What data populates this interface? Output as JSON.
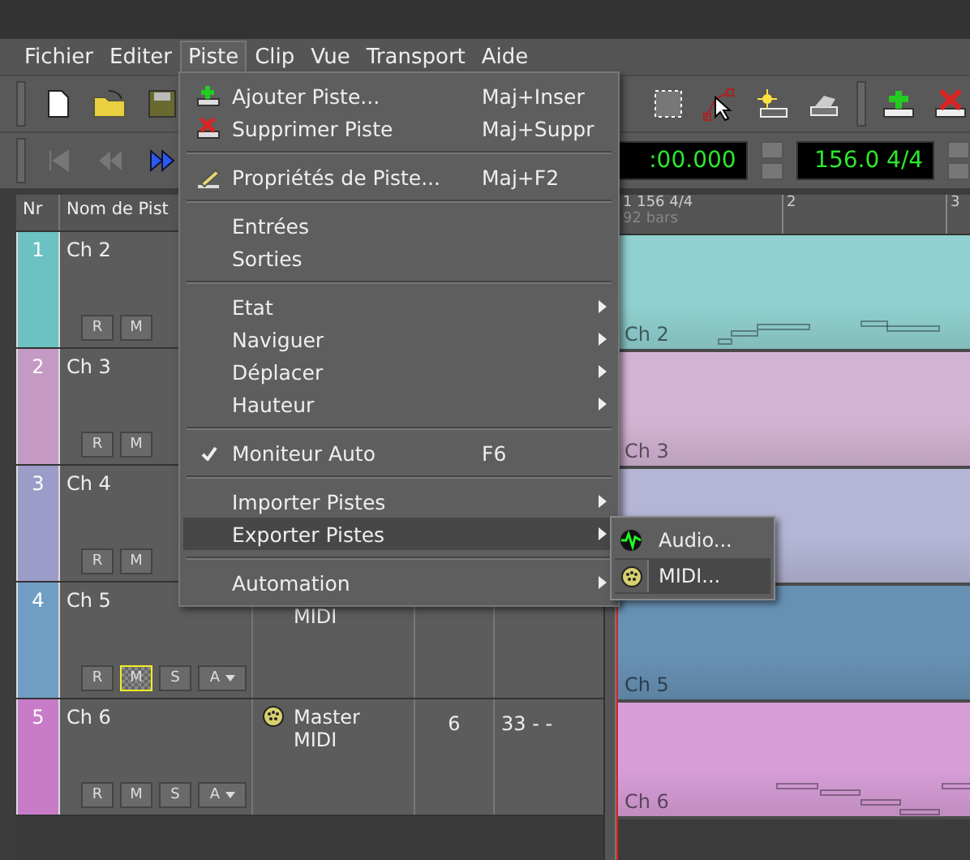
{
  "menubar": [
    {
      "label": "Fichier",
      "selected": false
    },
    {
      "label": "Editer",
      "selected": false
    },
    {
      "label": "Piste",
      "selected": true
    },
    {
      "label": "Clip",
      "selected": false
    },
    {
      "label": "Vue",
      "selected": false
    },
    {
      "label": "Transport",
      "selected": false
    },
    {
      "label": "Aide",
      "selected": false
    }
  ],
  "transport": {
    "time": ":00.000",
    "tempo": "156.0 4/4"
  },
  "tracklist": {
    "columns": [
      "Nr",
      "Nom de Pist"
    ]
  },
  "ruler": {
    "marks": [
      {
        "label": "1 156 4/4",
        "sub": "92 bars"
      },
      {
        "label": "2"
      },
      {
        "label": "3"
      }
    ]
  },
  "tracks": [
    {
      "number": "1",
      "name": "Ch 2",
      "color": "#6cc2c2",
      "clip_label": "Ch 2",
      "muted": false,
      "buttons": [
        "R",
        "M"
      ]
    },
    {
      "number": "2",
      "name": "Ch 3",
      "color": "#c49ac4",
      "clip_label": "Ch 3",
      "muted": false,
      "buttons": [
        "R",
        "M"
      ]
    },
    {
      "number": "3",
      "name": "Ch 4",
      "color": "#9c9cc8",
      "muted": false,
      "buttons": [
        "R",
        "M"
      ]
    },
    {
      "number": "4",
      "name": "Ch 5",
      "color": "#709ec4",
      "clip_label": "Ch 5",
      "muted": true,
      "buttons": [
        "R",
        "M",
        "S",
        "A"
      ],
      "output": [
        "MIDI"
      ]
    },
    {
      "number": "5",
      "name": "Ch 6",
      "color": "#c87cc8",
      "clip_label": "Ch 6",
      "muted": false,
      "buttons": [
        "R",
        "M",
        "S",
        "A"
      ],
      "output": [
        "Master",
        "MIDI"
      ],
      "channel": "6",
      "patch": "33 - -"
    }
  ],
  "menu": [
    {
      "kind": "item",
      "label": "Ajouter Piste...",
      "shortcut": "Maj+Inser",
      "submenu": false,
      "checked": false,
      "selected": false
    },
    {
      "kind": "item",
      "label": "Supprimer Piste",
      "shortcut": "Maj+Suppr",
      "submenu": false,
      "checked": false,
      "selected": false
    },
    {
      "kind": "separator"
    },
    {
      "kind": "item",
      "label": "Propriétés de Piste...",
      "shortcut": "Maj+F2",
      "submenu": false,
      "checked": false,
      "selected": false
    },
    {
      "kind": "separator"
    },
    {
      "kind": "item",
      "label": "Entrées",
      "submenu": false,
      "checked": false,
      "selected": false
    },
    {
      "kind": "item",
      "label": "Sorties",
      "submenu": false,
      "checked": false,
      "selected": false
    },
    {
      "kind": "separator"
    },
    {
      "kind": "item",
      "label": "Etat",
      "submenu": true,
      "checked": false,
      "selected": false
    },
    {
      "kind": "item",
      "label": "Naviguer",
      "submenu": true,
      "checked": false,
      "selected": false
    },
    {
      "kind": "item",
      "label": "Déplacer",
      "submenu": true,
      "checked": false,
      "selected": false
    },
    {
      "kind": "item",
      "label": "Hauteur",
      "submenu": true,
      "checked": false,
      "selected": false
    },
    {
      "kind": "separator"
    },
    {
      "kind": "item",
      "label": "Moniteur Auto",
      "shortcut": "F6",
      "submenu": false,
      "checked": true,
      "selected": false
    },
    {
      "kind": "separator"
    },
    {
      "kind": "item",
      "label": "Importer Pistes",
      "submenu": true,
      "checked": false,
      "selected": false
    },
    {
      "kind": "item",
      "label": "Exporter Pistes",
      "submenu": true,
      "checked": false,
      "selected": true
    },
    {
      "kind": "separator"
    },
    {
      "kind": "item",
      "label": "Automation",
      "submenu": true,
      "checked": false,
      "selected": false
    }
  ],
  "submenu": [
    {
      "label": "Audio...",
      "selected": false
    },
    {
      "label": "MIDI...",
      "selected": true
    }
  ]
}
